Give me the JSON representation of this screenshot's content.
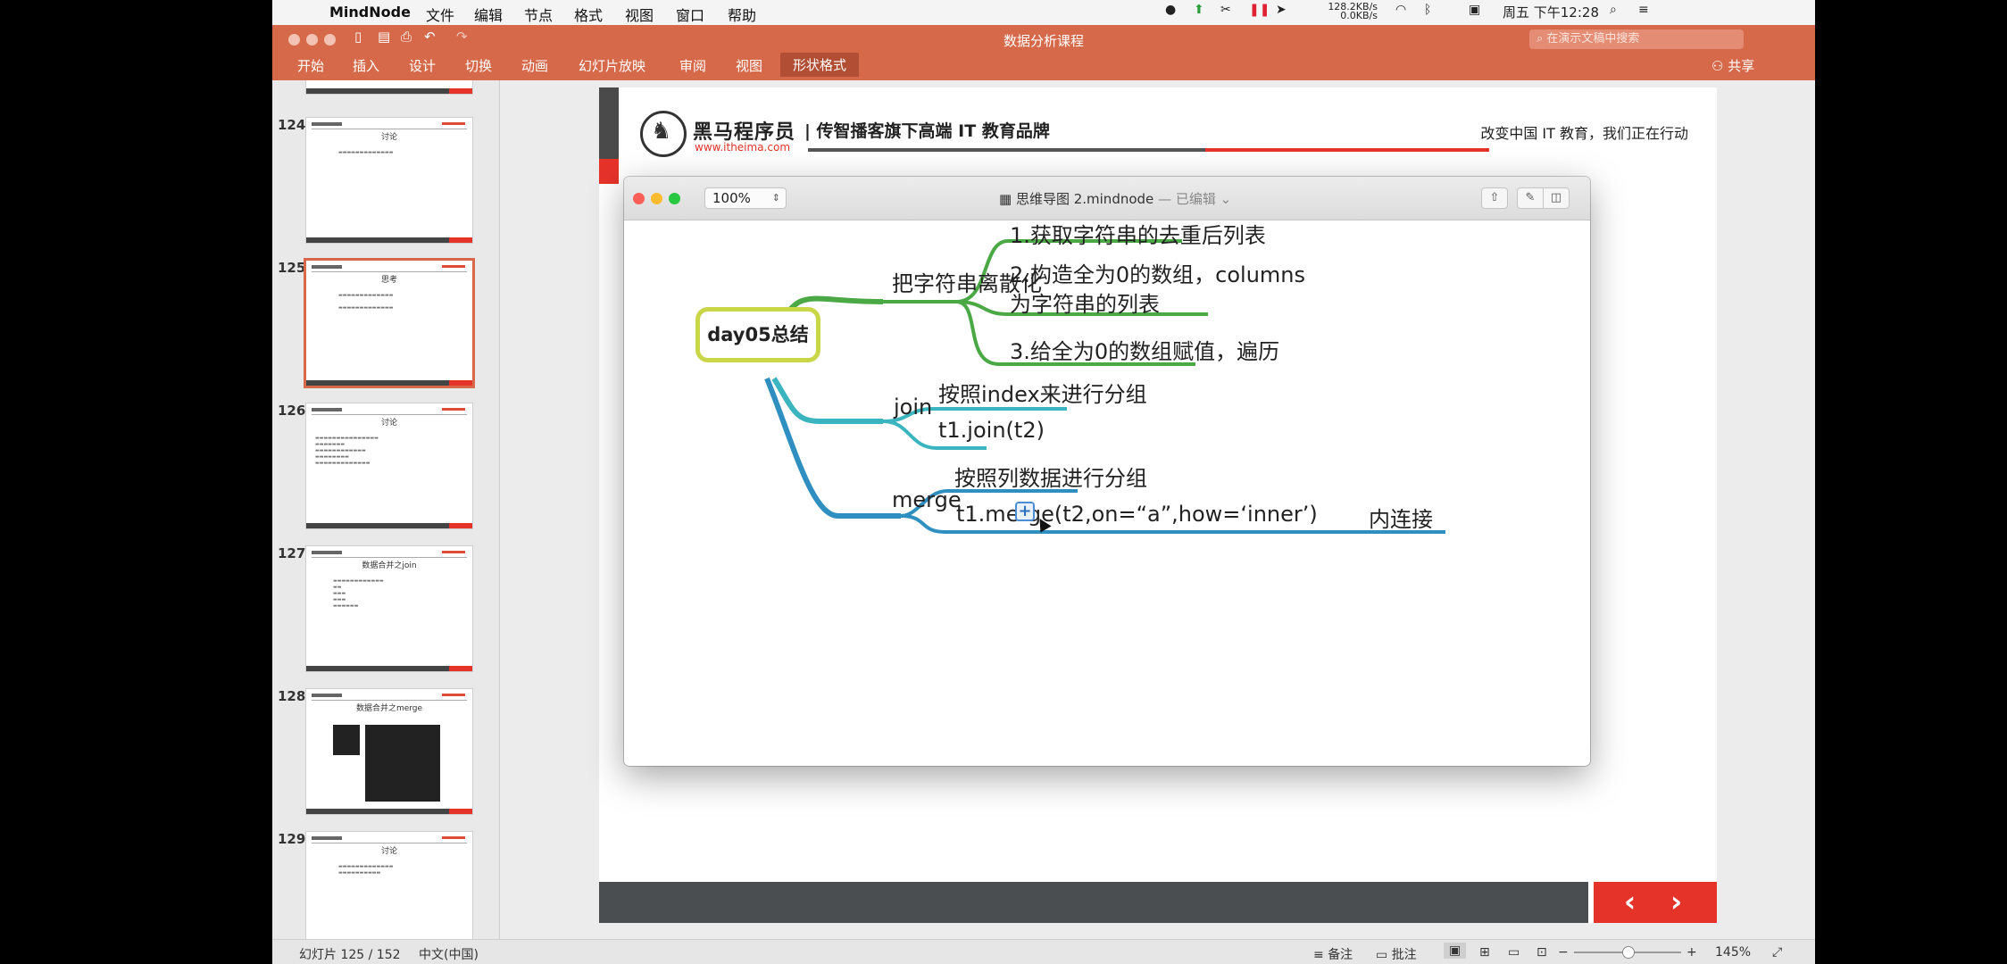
{
  "menubar": {
    "apple_icon": "apple-icon",
    "app_name": "MindNode",
    "items": [
      "文件",
      "编辑",
      "节点",
      "格式",
      "视图",
      "窗口",
      "帮助"
    ],
    "network_up": "128.2KB/s",
    "network_down": "0.0KB/s",
    "clock": "周五 下午12:28"
  },
  "ppt": {
    "doc_title": "数据分析课程",
    "search_placeholder": "在演示文稿中搜索",
    "tabs": [
      "开始",
      "插入",
      "设计",
      "切换",
      "动画",
      "幻灯片放映",
      "审阅",
      "视图",
      "形状格式"
    ],
    "active_tab": "形状格式",
    "share_label": "共享"
  },
  "thumbnails": [
    {
      "num": "124",
      "title": "讨论",
      "body": ""
    },
    {
      "num": "125",
      "title": "思考",
      "body": "",
      "selected": true
    },
    {
      "num": "126",
      "title": "讨论",
      "body": ""
    },
    {
      "num": "127",
      "title": "数据合并之join",
      "body": ""
    },
    {
      "num": "128",
      "title": "数据合并之merge",
      "body": ""
    },
    {
      "num": "129",
      "title": "讨论",
      "body": ""
    }
  ],
  "slide": {
    "brand": "黑马程序员",
    "brand_url": "www.itheima.com",
    "tagline": "| 传智播客旗下高端 IT 教育品牌",
    "slogan": "改变中国 IT 教育，我们正在行动",
    "nav_prev": "‹",
    "nav_next": "›"
  },
  "mindnode": {
    "zoom": "100%",
    "window_title": "思维导图 2.mindnode",
    "edited_label": "— 已编辑",
    "root": "day05总结",
    "branch1": "把字符串离散化",
    "branch1_children": [
      "1.获取字符串的去重后列表",
      "2.构造全为0的数组，columns",
      "为字符串的列表",
      "3.给全为0的数组赋值，遍历"
    ],
    "branch2": "join",
    "branch2_children": [
      "按照index来进行分组",
      "t1.join(t2)"
    ],
    "branch3": "merge",
    "branch3_children": [
      "按照列数据进行分组",
      "t1.merge(t2,on=“a”,how=‘inner’)"
    ],
    "branch3_grandchild": "内连接",
    "colors": {
      "green": "#4aa845",
      "teal": "#3ab5bf",
      "blue": "#2f8fc0",
      "root_border": "#c9d648"
    }
  },
  "statusbar": {
    "slide_info": "幻灯片 125 / 152",
    "language": "中文(中国)",
    "notes": "备注",
    "comments": "批注",
    "zoom": "145%"
  }
}
